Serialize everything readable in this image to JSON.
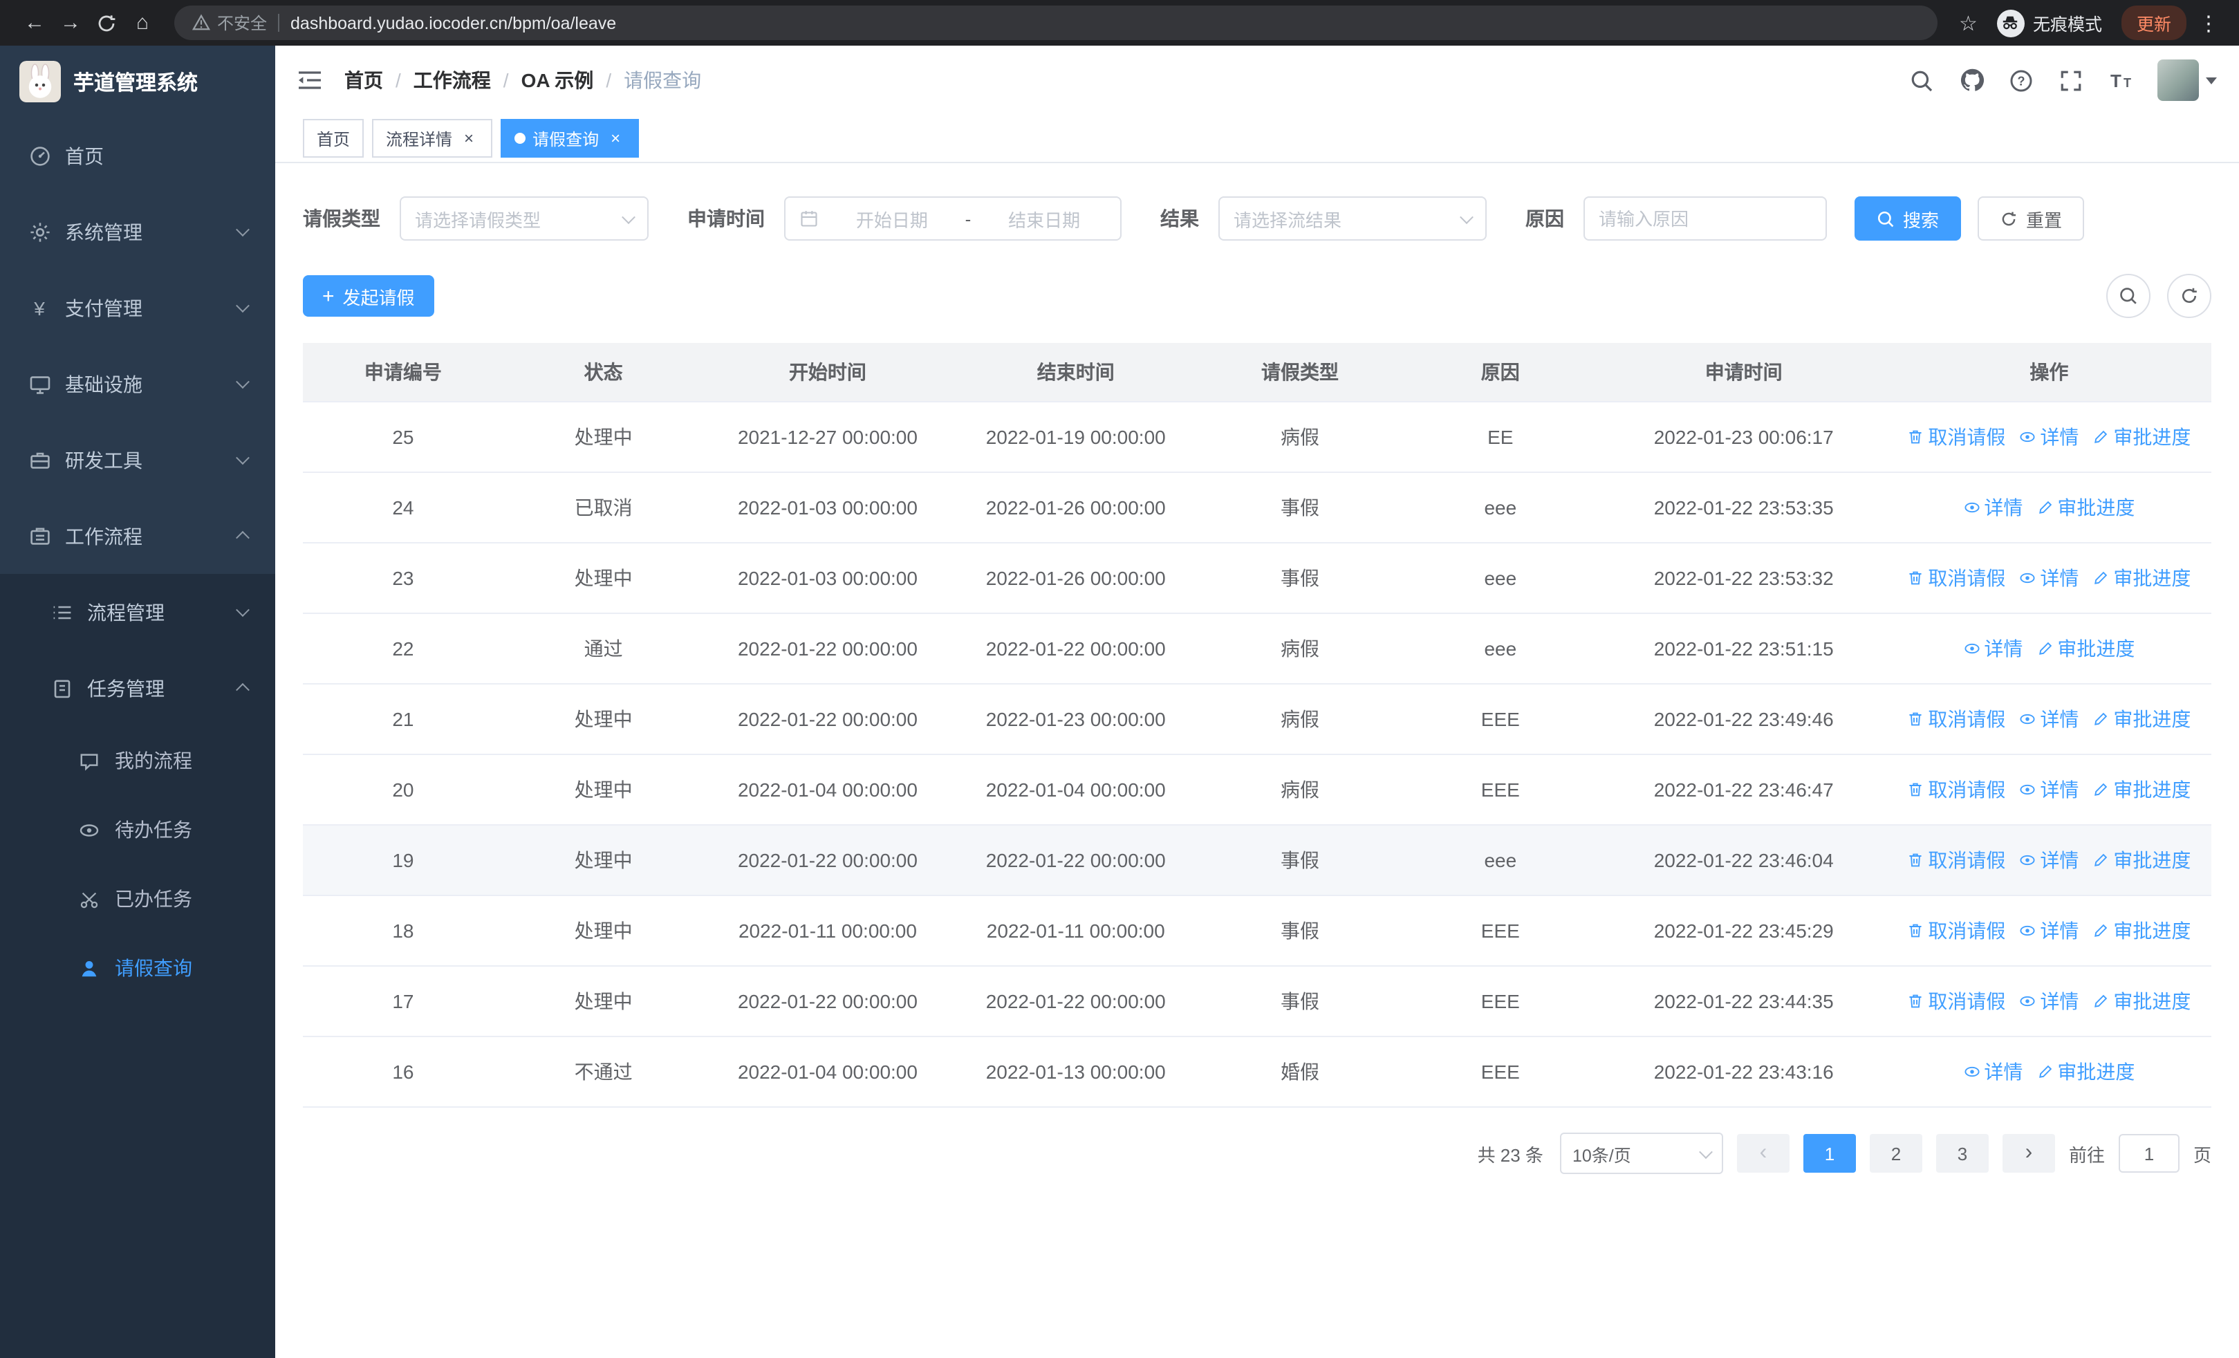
{
  "colors": {
    "primary": "#409eff",
    "sidebar_bg": "#2a3a4d",
    "submenu_bg": "#212e3e",
    "chrome_bg": "#202124"
  },
  "browser": {
    "security_label": "不安全",
    "url": "dashboard.yudao.iocoder.cn/bpm/oa/leave",
    "incognito_label": "无痕模式",
    "update_label": "更新"
  },
  "sidebar": {
    "app_title": "芋道管理系统",
    "items": [
      {
        "label": "首页"
      },
      {
        "label": "系统管理"
      },
      {
        "label": "支付管理"
      },
      {
        "label": "基础设施"
      },
      {
        "label": "研发工具"
      },
      {
        "label": "工作流程"
      },
      {
        "label": "流程管理"
      },
      {
        "label": "任务管理"
      },
      {
        "label": "我的流程"
      },
      {
        "label": "待办任务"
      },
      {
        "label": "已办任务"
      },
      {
        "label": "请假查询"
      }
    ]
  },
  "breadcrumb": {
    "separator": "/",
    "items": [
      "首页",
      "工作流程",
      "OA 示例",
      "请假查询"
    ]
  },
  "tabs": [
    {
      "label": "首页"
    },
    {
      "label": "流程详情"
    },
    {
      "label": "请假查询"
    }
  ],
  "filters": {
    "leave_type_label": "请假类型",
    "leave_type_placeholder": "请选择请假类型",
    "apply_time_label": "申请时间",
    "start_date_placeholder": "开始日期",
    "range_separator": "-",
    "end_date_placeholder": "结束日期",
    "result_label": "结果",
    "result_placeholder": "请选择流结果",
    "reason_label": "原因",
    "reason_placeholder": "请输入原因",
    "search_label": "搜索",
    "reset_label": "重置"
  },
  "toolbar": {
    "create_label": "发起请假"
  },
  "table": {
    "headers": [
      "申请编号",
      "状态",
      "开始时间",
      "结束时间",
      "请假类型",
      "原因",
      "申请时间",
      "操作"
    ],
    "action_labels": {
      "cancel": "取消请假",
      "detail": "详情",
      "progress": "审批进度"
    },
    "rows": [
      {
        "id": "25",
        "status": "处理中",
        "start": "2021-12-27 00:00:00",
        "end": "2022-01-19 00:00:00",
        "type": "病假",
        "reason": "EE",
        "applied": "2022-01-23 00:06:17",
        "actions": [
          "cancel",
          "detail",
          "progress"
        ]
      },
      {
        "id": "24",
        "status": "已取消",
        "start": "2022-01-03 00:00:00",
        "end": "2022-01-26 00:00:00",
        "type": "事假",
        "reason": "eee",
        "applied": "2022-01-22 23:53:35",
        "actions": [
          "detail",
          "progress"
        ]
      },
      {
        "id": "23",
        "status": "处理中",
        "start": "2022-01-03 00:00:00",
        "end": "2022-01-26 00:00:00",
        "type": "事假",
        "reason": "eee",
        "applied": "2022-01-22 23:53:32",
        "actions": [
          "cancel",
          "detail",
          "progress"
        ]
      },
      {
        "id": "22",
        "status": "通过",
        "start": "2022-01-22 00:00:00",
        "end": "2022-01-22 00:00:00",
        "type": "病假",
        "reason": "eee",
        "applied": "2022-01-22 23:51:15",
        "actions": [
          "detail",
          "progress"
        ]
      },
      {
        "id": "21",
        "status": "处理中",
        "start": "2022-01-22 00:00:00",
        "end": "2022-01-23 00:00:00",
        "type": "病假",
        "reason": "EEE",
        "applied": "2022-01-22 23:49:46",
        "actions": [
          "cancel",
          "detail",
          "progress"
        ]
      },
      {
        "id": "20",
        "status": "处理中",
        "start": "2022-01-04 00:00:00",
        "end": "2022-01-04 00:00:00",
        "type": "病假",
        "reason": "EEE",
        "applied": "2022-01-22 23:46:47",
        "actions": [
          "cancel",
          "detail",
          "progress"
        ]
      },
      {
        "id": "19",
        "status": "处理中",
        "start": "2022-01-22 00:00:00",
        "end": "2022-01-22 00:00:00",
        "type": "事假",
        "reason": "eee",
        "applied": "2022-01-22 23:46:04",
        "actions": [
          "cancel",
          "detail",
          "progress"
        ],
        "highlighted": true
      },
      {
        "id": "18",
        "status": "处理中",
        "start": "2022-01-11 00:00:00",
        "end": "2022-01-11 00:00:00",
        "type": "事假",
        "reason": "EEE",
        "applied": "2022-01-22 23:45:29",
        "actions": [
          "cancel",
          "detail",
          "progress"
        ]
      },
      {
        "id": "17",
        "status": "处理中",
        "start": "2022-01-22 00:00:00",
        "end": "2022-01-22 00:00:00",
        "type": "事假",
        "reason": "EEE",
        "applied": "2022-01-22 23:44:35",
        "actions": [
          "cancel",
          "detail",
          "progress"
        ]
      },
      {
        "id": "16",
        "status": "不通过",
        "start": "2022-01-04 00:00:00",
        "end": "2022-01-13 00:00:00",
        "type": "婚假",
        "reason": "EEE",
        "applied": "2022-01-22 23:43:16",
        "actions": [
          "detail",
          "progress"
        ]
      }
    ]
  },
  "pagination": {
    "total_text": "共 23 条",
    "page_size_value": "10条/页",
    "prev_icon": "‹",
    "next_icon": "›",
    "pages": [
      "1",
      "2",
      "3"
    ],
    "active_page": "1",
    "goto_label": "前往",
    "goto_value": "1",
    "goto_suffix": "页"
  }
}
